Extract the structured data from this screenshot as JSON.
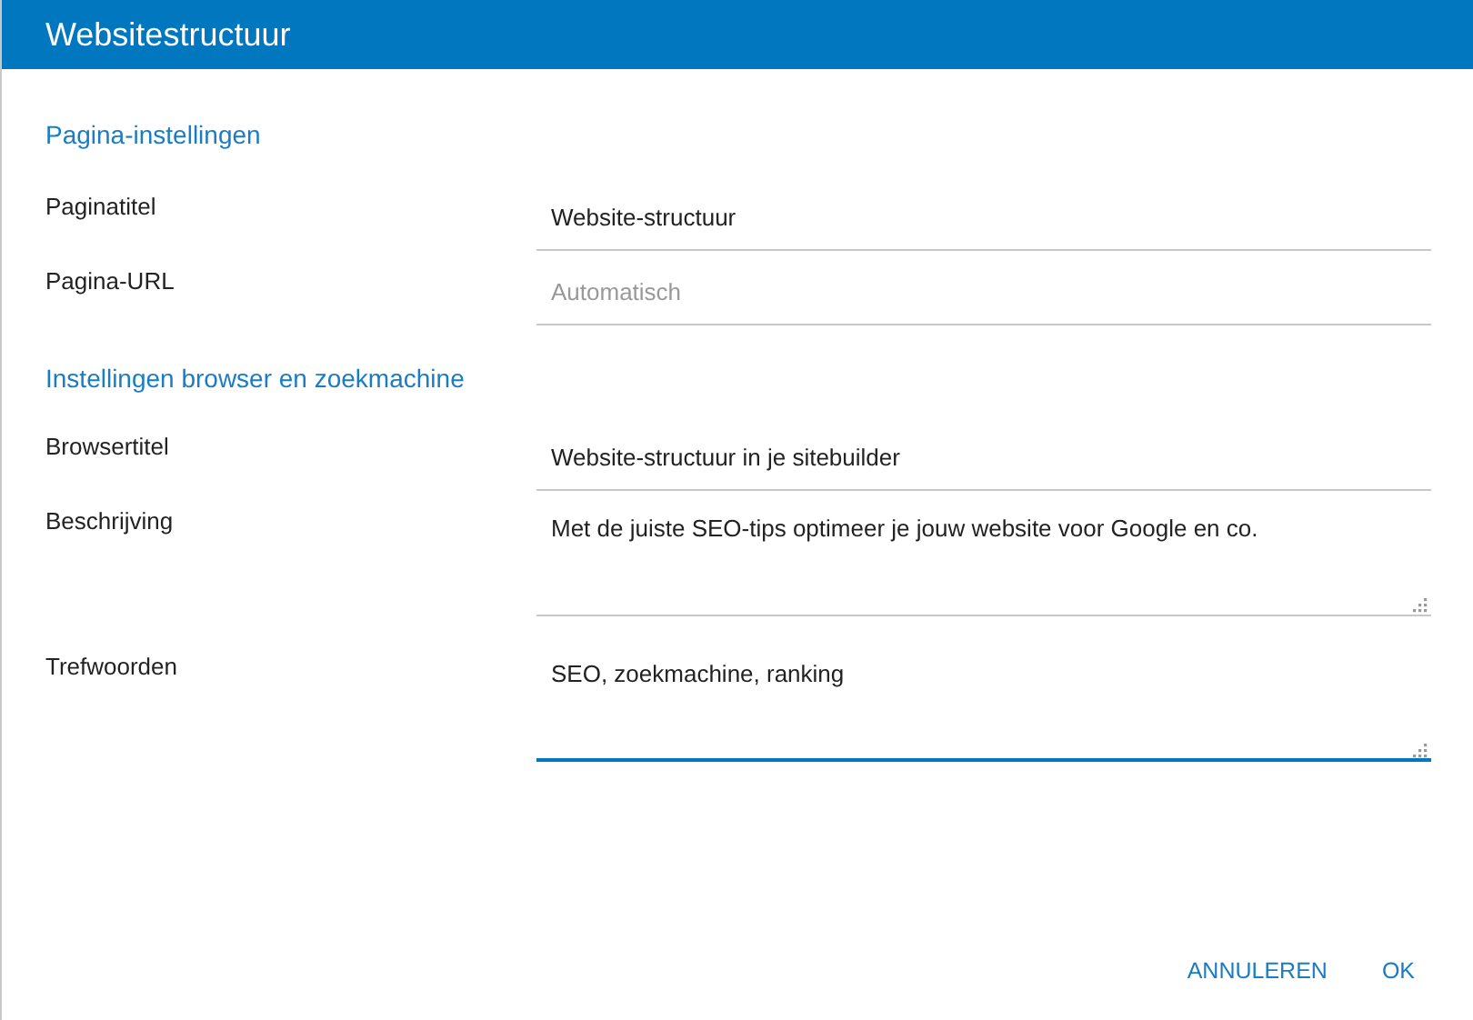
{
  "window": {
    "title": "Websitestructuur"
  },
  "sections": [
    {
      "title": "Pagina-instellingen",
      "fields": [
        {
          "label": "Paginatitel",
          "kind": "input",
          "value": "Website-structuur",
          "focused": false
        },
        {
          "label": "Pagina-URL",
          "kind": "input",
          "placeholder": "Automatisch",
          "focused": false
        }
      ]
    },
    {
      "title": "Instellingen browser en zoekmachine",
      "fields": [
        {
          "label": "Browsertitel",
          "kind": "input",
          "value": "Website-structuur in je sitebuilder",
          "focused": false
        },
        {
          "label": "Beschrijving",
          "kind": "textarea",
          "value": "Met de juiste SEO-tips optimeer je jouw website voor Google en co.",
          "focused": false
        },
        {
          "label": "Trefwoorden",
          "kind": "textarea",
          "value": "SEO, zoekmachine, ranking",
          "focused": true
        }
      ]
    }
  ],
  "buttons": [
    "ANNULEREN",
    "OK"
  ]
}
